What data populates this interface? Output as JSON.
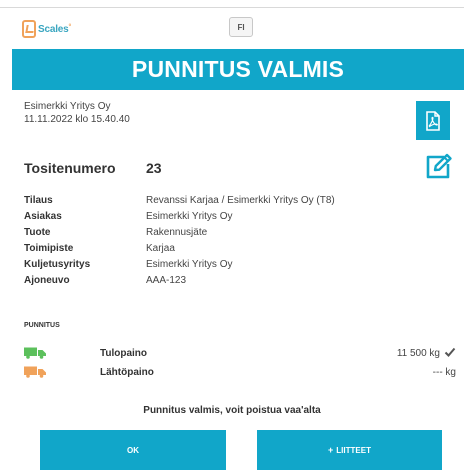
{
  "header": {
    "logo_text": "Scales",
    "language": "FI"
  },
  "banner": {
    "title": "PUNNITUS VALMIS"
  },
  "meta": {
    "company": "Esimerkki Yritys Oy",
    "datetime": "11.11.2022 klo 15.40.40"
  },
  "voucher": {
    "label": "Tositenumero",
    "value": "23"
  },
  "details": [
    {
      "label": "Tilaus",
      "value": "Revanssi Karjaa / Esimerkki Yritys Oy (T8)"
    },
    {
      "label": "Asiakas",
      "value": "Esimerkki Yritys Oy"
    },
    {
      "label": "Tuote",
      "value": "Rakennusjäte"
    },
    {
      "label": "Toimipiste",
      "value": "Karjaa"
    },
    {
      "label": "Kuljetusyritys",
      "value": "Esimerkki Yritys Oy"
    },
    {
      "label": "Ajoneuvo",
      "value": "AAA-123"
    }
  ],
  "weighing": {
    "section_title": "PUNNITUS",
    "rows": [
      {
        "label": "Tulopaino",
        "value": "11 500 kg",
        "icon": "truck-icon",
        "icon_color": "#5cc05c",
        "done": true
      },
      {
        "label": "Lähtöpaino",
        "value": "--- kg",
        "icon": "truck-icon",
        "icon_color": "#f0a25a",
        "done": false
      }
    ]
  },
  "status": "Punnitus valmis, voit poistua vaa'alta",
  "buttons": {
    "ok": "OK",
    "attachments": "LIITTEET"
  },
  "colors": {
    "accent": "#11a6c9",
    "logo_orange": "#f0a25a"
  }
}
